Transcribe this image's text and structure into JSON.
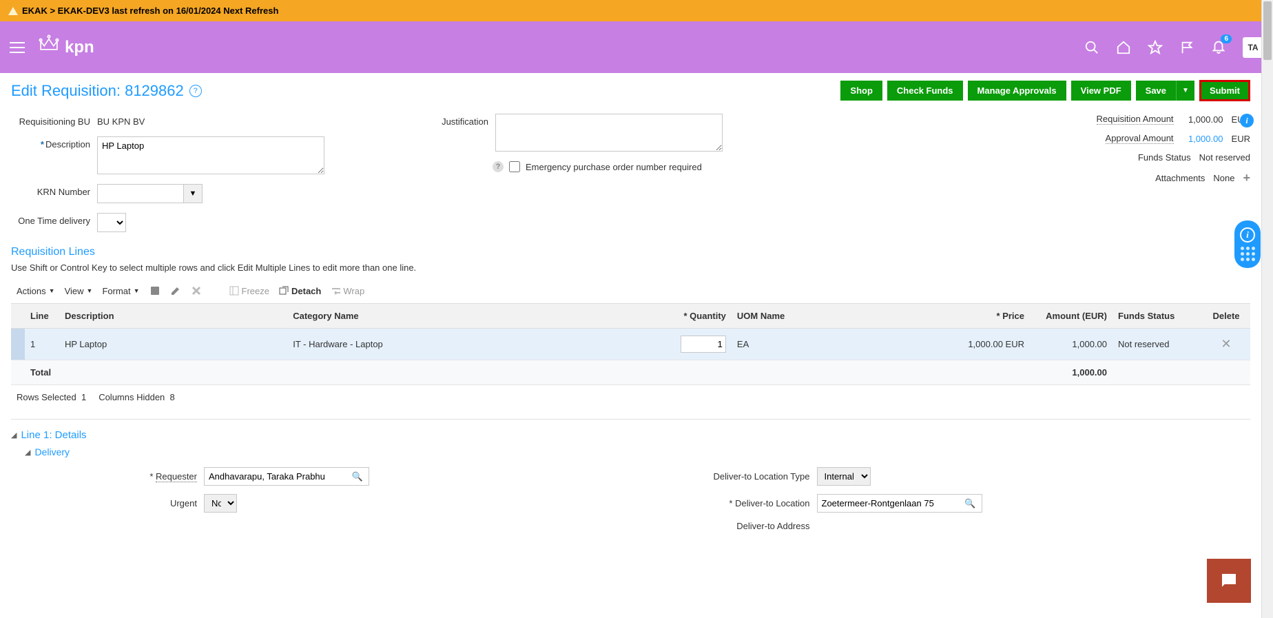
{
  "banner": {
    "text": "EKAK > EKAK-DEV3 last refresh on 16/01/2024 Next Refresh"
  },
  "header": {
    "logo_text": "kpn",
    "notification_count": "6",
    "avatar": "TA"
  },
  "page": {
    "title": "Edit Requisition: 8129862"
  },
  "buttons": {
    "shop": "Shop",
    "check_funds": "Check Funds",
    "manage_approvals": "Manage Approvals",
    "view_pdf": "View PDF",
    "save": "Save",
    "submit": "Submit"
  },
  "form": {
    "req_bu_label": "Requisitioning BU",
    "req_bu_value": "BU KPN BV",
    "description_label": "Description",
    "description_value": "HP Laptop",
    "krn_label": "KRN Number",
    "one_time_label": "One Time delivery",
    "justification_label": "Justification",
    "emergency_label": "Emergency purchase order number required"
  },
  "summary": {
    "req_amount_label": "Requisition Amount",
    "req_amount_val": "1,000.00",
    "req_amount_cur": "EUR",
    "app_amount_label": "Approval Amount",
    "app_amount_val": "1,000.00",
    "app_amount_cur": "EUR",
    "funds_label": "Funds Status",
    "funds_val": "Not reserved",
    "attach_label": "Attachments",
    "attach_val": "None"
  },
  "lines": {
    "heading": "Requisition Lines",
    "hint": "Use Shift or Control Key to select multiple rows and click Edit Multiple Lines to edit more than one line.",
    "toolbar": {
      "actions": "Actions",
      "view": "View",
      "format": "Format",
      "freeze": "Freeze",
      "detach": "Detach",
      "wrap": "Wrap"
    },
    "cols": {
      "line": "Line",
      "desc": "Description",
      "cat": "Category Name",
      "qty": "Quantity",
      "uom": "UOM Name",
      "price": "Price",
      "amount": "Amount (EUR)",
      "funds": "Funds Status",
      "del": "Delete"
    },
    "row1": {
      "line": "1",
      "desc": "HP Laptop",
      "cat": "IT - Hardware - Laptop",
      "qty": "1",
      "uom": "EA",
      "price": "1,000.00 EUR",
      "amount": "1,000.00",
      "funds": "Not reserved"
    },
    "total_label": "Total",
    "total_amount": "1,000.00",
    "footer_rows": "Rows Selected",
    "footer_rows_n": "1",
    "footer_cols": "Columns Hidden",
    "footer_cols_n": "8"
  },
  "details": {
    "line_heading": "Line 1: Details",
    "delivery_heading": "Delivery",
    "requester_label": "Requester",
    "requester_value": "Andhavarapu, Taraka Prabhu",
    "urgent_label": "Urgent",
    "urgent_value": "No",
    "deliver_type_label": "Deliver-to Location Type",
    "deliver_type_value": "Internal",
    "deliver_loc_label": "Deliver-to Location",
    "deliver_loc_value": "Zoetermeer-Rontgenlaan 75",
    "deliver_addr_label": "Deliver-to Address"
  }
}
